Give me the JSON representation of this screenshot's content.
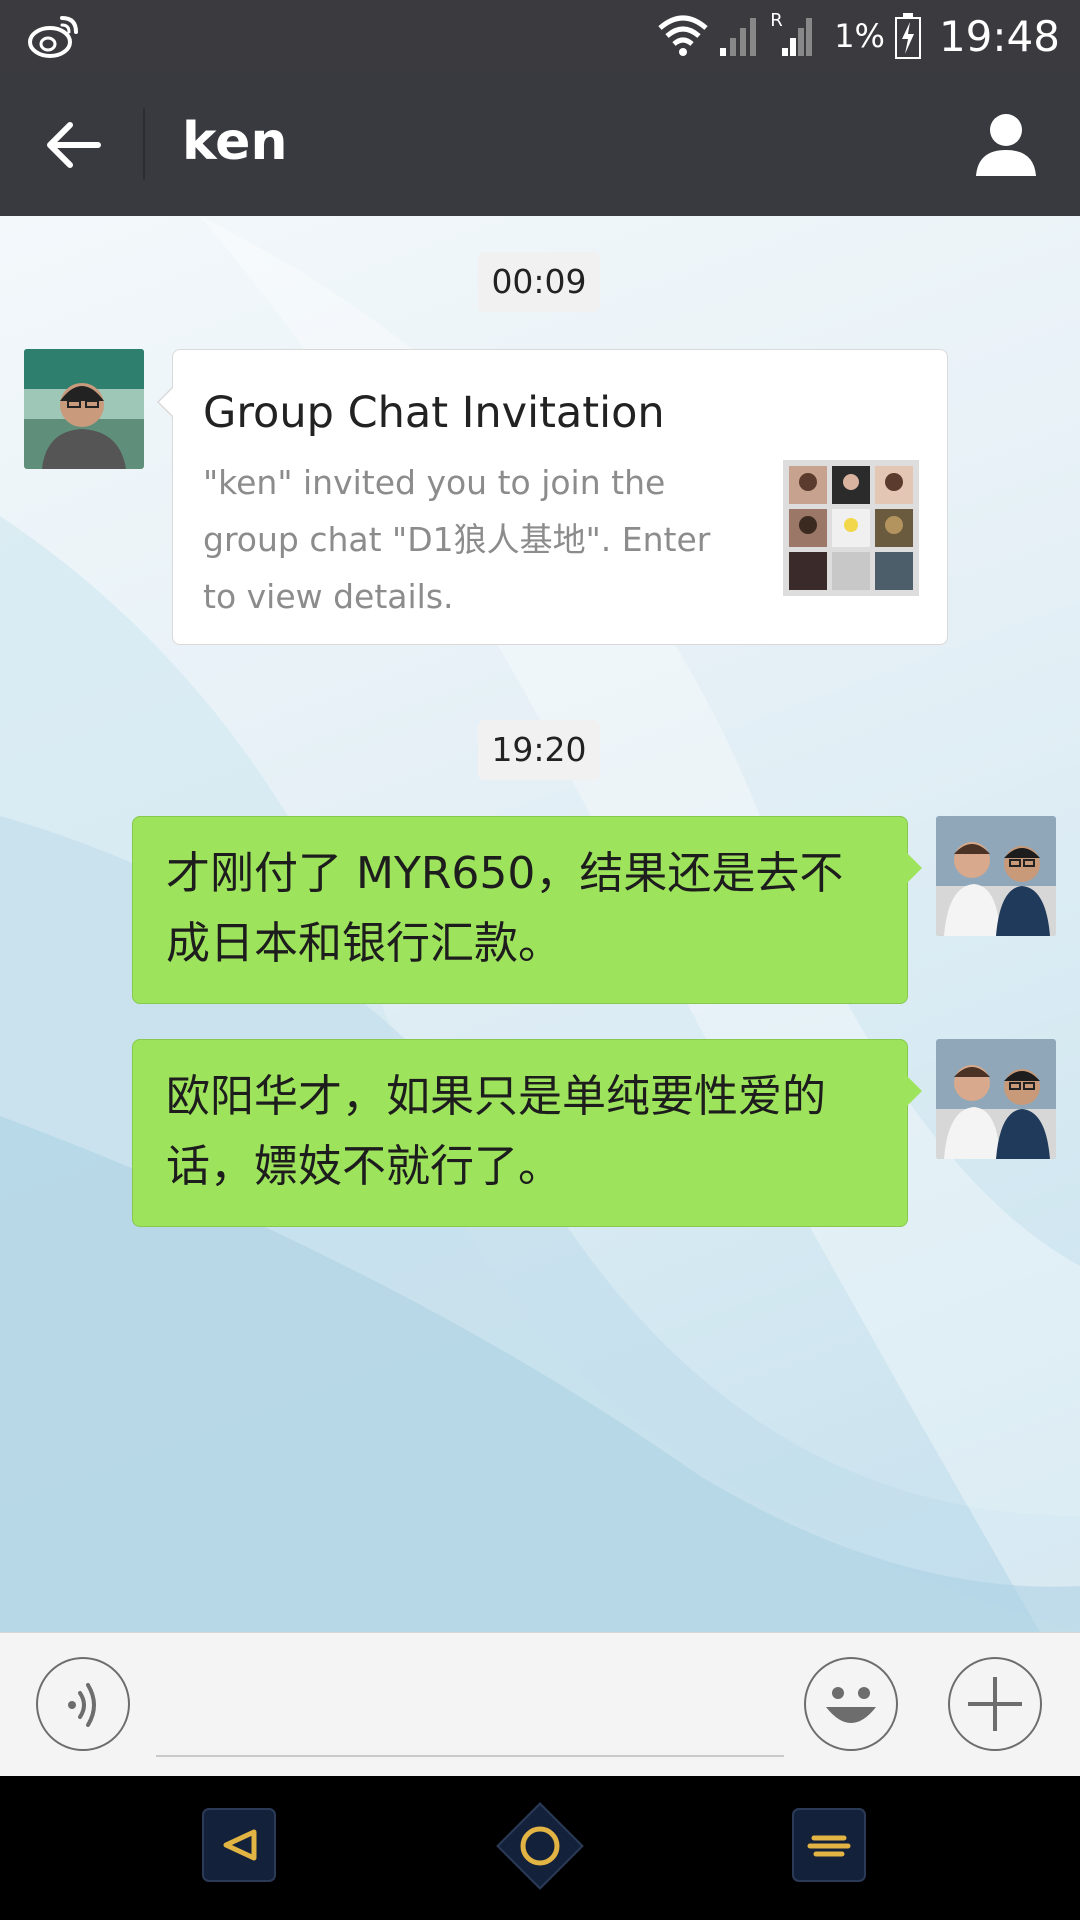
{
  "status_bar": {
    "roaming_indicator": "R",
    "battery_percent": "1%",
    "time": "19:48"
  },
  "header": {
    "title": "ken"
  },
  "messages": [
    {
      "type": "timestamp",
      "text": "00:09"
    },
    {
      "type": "card",
      "sender": "ken",
      "title": "Group Chat Invitation",
      "description": "\"ken\" invited you to join the group chat \"D1狼人基地\". Enter to view details."
    },
    {
      "type": "timestamp",
      "text": "19:20"
    },
    {
      "type": "text",
      "sender": "me",
      "text": "才刚付了 MYR650，结果还是去不成日本和银行汇款。"
    },
    {
      "type": "text",
      "sender": "me",
      "text": "欧阳华才，如果只是单纯要性爱的话，嫖妓不就行了。"
    }
  ],
  "input_bar": {
    "placeholder": ""
  },
  "icons": {
    "status_app": "weibo-icon",
    "back": "arrow-left-icon",
    "profile": "person-icon",
    "voice": "voice-icon",
    "emoji": "emoji-icon",
    "more": "plus-icon",
    "nav_back": "triangle-back-icon",
    "nav_home": "circle-home-icon",
    "nav_menu": "menu-lines-icon"
  },
  "colors": {
    "title_bar": "#393a3f",
    "status_bar": "#3a3a3f",
    "outgoing_bubble": "#9ee35c",
    "card_background": "#ffffff",
    "nav_accent": "#e2b443"
  }
}
